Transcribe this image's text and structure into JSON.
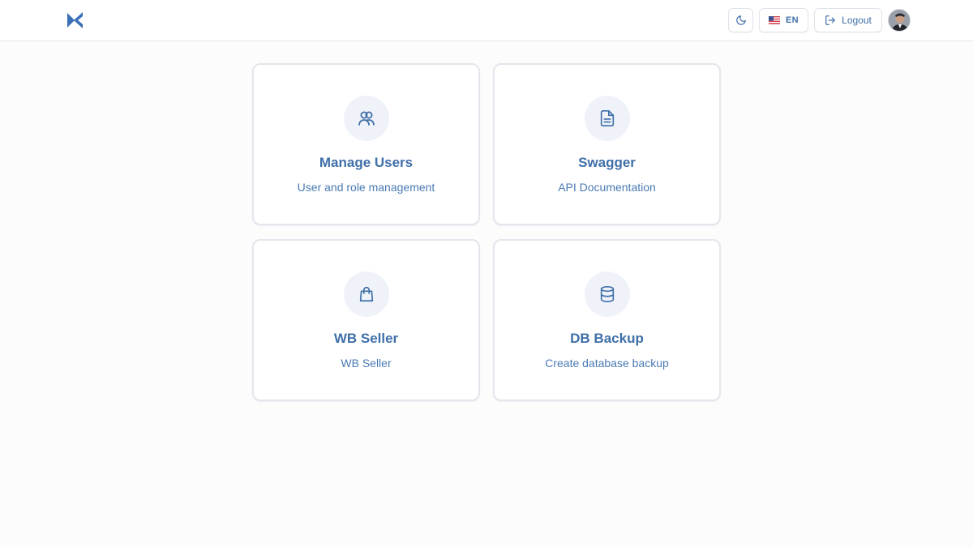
{
  "header": {
    "logo_icon": "x-logo-icon",
    "theme_icon": "moon-icon",
    "language": {
      "flag_icon": "us-flag-icon",
      "label": "EN"
    },
    "logout": {
      "icon": "logout-icon",
      "label": "Logout"
    },
    "avatar_icon": "user-avatar"
  },
  "cards": [
    {
      "icon": "users-icon",
      "title": "Manage Users",
      "subtitle": "User and role management"
    },
    {
      "icon": "document-icon",
      "title": "Swagger",
      "subtitle": "API Documentation"
    },
    {
      "icon": "shopping-bag-icon",
      "title": "WB Seller",
      "subtitle": "WB Seller"
    },
    {
      "icon": "database-icon",
      "title": "DB Backup",
      "subtitle": "Create database backup"
    }
  ],
  "colors": {
    "accent": "#3f6fa8",
    "icon_bg": "#eff3f9",
    "border": "#e3e6ec",
    "background": "#fcfcfd"
  }
}
